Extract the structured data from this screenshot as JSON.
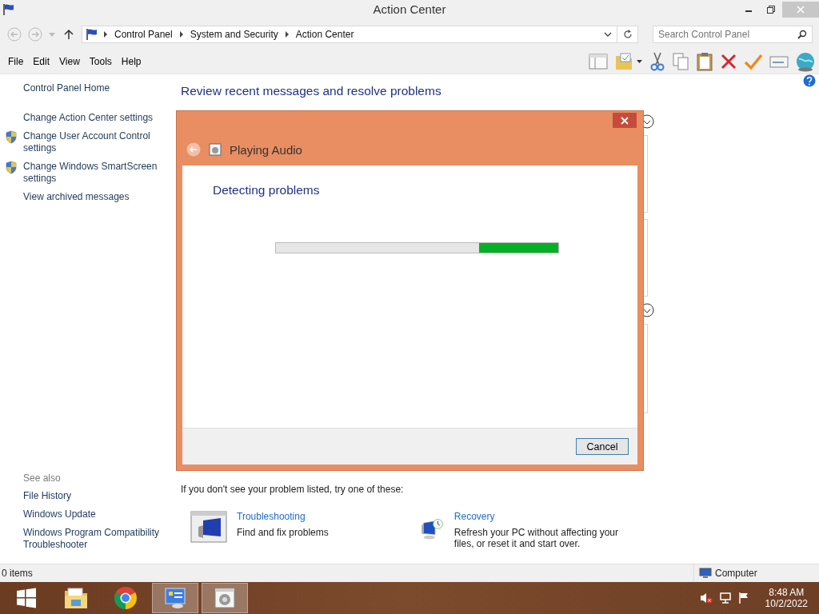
{
  "window": {
    "title": "Action Center"
  },
  "address": {
    "crumbs": [
      "Control Panel",
      "System and Security",
      "Action Center"
    ],
    "search": {
      "placeholder": "Search Control Panel"
    }
  },
  "menu": [
    "File",
    "Edit",
    "View",
    "Tools",
    "Help"
  ],
  "sidebar": {
    "home": "Control Panel Home",
    "links": [
      {
        "label": "Change Action Center settings",
        "shield": false
      },
      {
        "label": "Change User Account Control settings",
        "shield": true
      },
      {
        "label": "Change Windows SmartScreen settings",
        "shield": true
      },
      {
        "label": "View archived messages",
        "shield": false
      }
    ],
    "see_also": {
      "heading": "See also",
      "links": [
        "File History",
        "Windows Update",
        "Windows Program Compatibility Troubleshooter"
      ]
    }
  },
  "content": {
    "heading": "Review recent messages and resolve problems",
    "note": "If you don't see your problem listed, try one of these:",
    "options": [
      {
        "kind": "troubleshooting",
        "title": "Troubleshooting",
        "description": "Find and fix problems"
      },
      {
        "kind": "recovery",
        "title": "Recovery",
        "description": "Refresh your PC without affecting your files, or reset it and start over."
      }
    ]
  },
  "dialog": {
    "title": "Playing Audio",
    "heading": "Detecting problems",
    "progress": {
      "level": 0.28
    },
    "buttons": [
      "Cancel"
    ]
  },
  "status_bar": {
    "items": "0 items",
    "location": "Computer"
  },
  "taskbar": {
    "apps": [
      {
        "kind": "start",
        "running": false
      },
      {
        "kind": "folder",
        "running": false
      },
      {
        "kind": "browser",
        "running": false
      },
      {
        "kind": "control-panel",
        "running": true
      },
      {
        "kind": "troubleshooter",
        "running": true
      }
    ],
    "time": "8:48 AM",
    "date": "10/2/2022"
  }
}
